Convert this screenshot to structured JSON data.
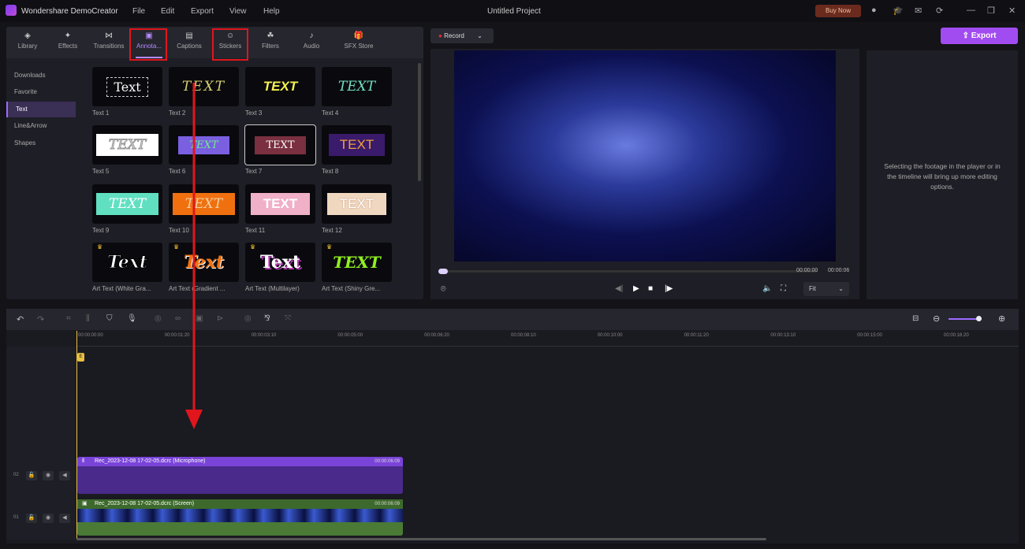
{
  "app": {
    "name": "Wondershare DemoCreator",
    "project_title": "Untitled Project",
    "buy_now": "Buy Now",
    "menu": [
      "File",
      "Edit",
      "Export",
      "View",
      "Help"
    ]
  },
  "tabs": [
    {
      "label": "Library",
      "icon": "layers-icon"
    },
    {
      "label": "Effects",
      "icon": "sparkle-icon"
    },
    {
      "label": "Transitions",
      "icon": "transition-icon"
    },
    {
      "label": "Annota...",
      "icon": "annotation-icon",
      "active": true
    },
    {
      "label": "Captions",
      "icon": "caption-icon"
    },
    {
      "label": "Stickers",
      "icon": "sticker-icon"
    },
    {
      "label": "Filters",
      "icon": "filter-icon"
    },
    {
      "label": "Audio",
      "icon": "music-icon"
    },
    {
      "label": "SFX Store",
      "icon": "gift-icon"
    }
  ],
  "sidebar": [
    {
      "label": "Downloads"
    },
    {
      "label": "Favorite"
    },
    {
      "label": "Text",
      "active": true
    },
    {
      "label": "Line&Arrow"
    },
    {
      "label": "Shapes"
    }
  ],
  "thumbnails": [
    {
      "label": "Text 1",
      "text": "Text"
    },
    {
      "label": "Text 2",
      "text": "TEXT"
    },
    {
      "label": "Text 3",
      "text": "TEXT"
    },
    {
      "label": "Text 4",
      "text": "TEXT"
    },
    {
      "label": "Text 5",
      "text": "TEXT"
    },
    {
      "label": "Text 6",
      "text": "TEXT"
    },
    {
      "label": "Text 7",
      "text": "TEXT"
    },
    {
      "label": "Text 8",
      "text": "TEXT"
    },
    {
      "label": "Text 9",
      "text": "TEXT"
    },
    {
      "label": "Text 10",
      "text": "TEXT"
    },
    {
      "label": "Text 11",
      "text": "TEXT"
    },
    {
      "label": "Text 12",
      "text": "TEXT"
    },
    {
      "label": "Art Text (White Gra...",
      "text": "Text"
    },
    {
      "label": "Art Text (Gradient ...",
      "text": "Text"
    },
    {
      "label": "Art Text (Multilayer)",
      "text": "Text"
    },
    {
      "label": "Art Text (Shiny Gre...",
      "text": "TEXT"
    }
  ],
  "player": {
    "record": "Record",
    "export": "Export",
    "current_time": "00:00:00",
    "total_time": "00:00:06",
    "fit": "Fit",
    "hint": "Selecting the footage in the player or in the timeline will bring up more editing options."
  },
  "ruler": [
    "00:00:00:00",
    "00:00:01:20",
    "00:00:03:10",
    "00:00:05:00",
    "00:00:06:20",
    "00:00:08:10",
    "00:00:10:00",
    "00:00:11:20",
    "00:00:13:10",
    "00:00:15:00",
    "00:00:16:20"
  ],
  "tracks": [
    {
      "number": "02",
      "clip": "Rec_2023-12-08 17-02-05.dcrc (Microphone)",
      "duration": "00:00:06:09"
    },
    {
      "number": "01",
      "clip": "Rec_2023-12-08 17-02-05.dcrc (Screen)",
      "duration": "00:00:06:09"
    }
  ],
  "colors": {
    "accent": "#a14cf0",
    "highlight": "#e0161c",
    "mic_clip": "#7a44d8",
    "screen_clip": "#4a7a36"
  }
}
